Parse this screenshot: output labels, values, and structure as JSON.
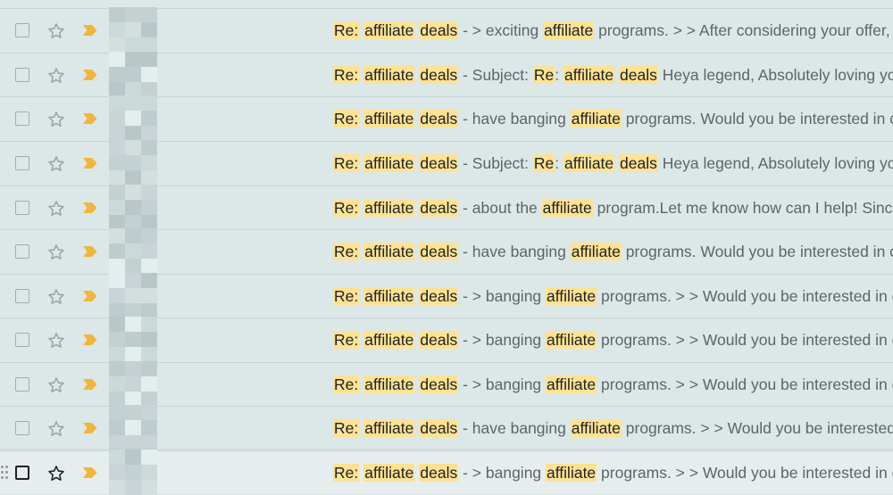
{
  "emails": [
    {
      "prefix": "Re:",
      "w1": "affiliate",
      "w2": "deals",
      "sep": "-",
      "body": [
        {
          "t": "> exciting "
        },
        {
          "t": "affiliate",
          "h": true
        },
        {
          "t": " programs. > > After considering your offer,"
        }
      ]
    },
    {
      "prefix": "Re:",
      "w1": "affiliate",
      "w2": "deals",
      "sep": "-",
      "body": [
        {
          "t": "Subject: "
        },
        {
          "t": "Re",
          "h": true
        },
        {
          "t": ": "
        },
        {
          "t": "affiliate",
          "h": true
        },
        {
          "t": " "
        },
        {
          "t": "deals",
          "h": true
        },
        {
          "t": " Heya legend, Absolutely loving you"
        }
      ]
    },
    {
      "prefix": "Re:",
      "w1": "affiliate",
      "w2": "deals",
      "sep": "-",
      "body": [
        {
          "t": "have banging "
        },
        {
          "t": "affiliate",
          "h": true
        },
        {
          "t": " programs. Would you be interested in c"
        }
      ]
    },
    {
      "prefix": "Re:",
      "w1": "affiliate",
      "w2": "deals",
      "sep": "-",
      "body": [
        {
          "t": "Subject: "
        },
        {
          "t": "Re",
          "h": true
        },
        {
          "t": ": "
        },
        {
          "t": "affiliate",
          "h": true
        },
        {
          "t": " "
        },
        {
          "t": "deals",
          "h": true
        },
        {
          "t": " Heya legend, Absolutely loving you"
        }
      ]
    },
    {
      "prefix": "Re:",
      "w1": "affiliate",
      "w2": "deals",
      "sep": "-",
      "body": [
        {
          "t": "about the "
        },
        {
          "t": "affiliate",
          "h": true
        },
        {
          "t": " program.Let me know how can I help! Sinc"
        }
      ]
    },
    {
      "prefix": "Re:",
      "w1": "affiliate",
      "w2": "deals",
      "sep": "-",
      "body": [
        {
          "t": "have banging "
        },
        {
          "t": "affiliate",
          "h": true
        },
        {
          "t": " programs. Would you be interested in c"
        }
      ]
    },
    {
      "prefix": "Re:",
      "w1": "affiliate",
      "w2": "deals",
      "sep": "-",
      "body": [
        {
          "t": "> banging "
        },
        {
          "t": "affiliate",
          "h": true
        },
        {
          "t": " programs. > > Would you be interested in c"
        }
      ]
    },
    {
      "prefix": "Re:",
      "w1": "affiliate",
      "w2": "deals",
      "sep": "-",
      "body": [
        {
          "t": "> banging "
        },
        {
          "t": "affiliate",
          "h": true
        },
        {
          "t": " programs. > > Would you be interested in c"
        }
      ]
    },
    {
      "prefix": "Re:",
      "w1": "affiliate",
      "w2": "deals",
      "sep": "-",
      "body": [
        {
          "t": "> banging "
        },
        {
          "t": "affiliate",
          "h": true
        },
        {
          "t": " programs. > > Would you be interested in c"
        }
      ]
    },
    {
      "prefix": "Re:",
      "w1": "affiliate",
      "w2": "deals",
      "sep": "-",
      "body": [
        {
          "t": "have banging "
        },
        {
          "t": "affiliate",
          "h": true
        },
        {
          "t": " programs. > > Would you be interested "
        }
      ]
    },
    {
      "prefix": "Re:",
      "w1": "affiliate",
      "w2": "deals",
      "sep": "-",
      "body": [
        {
          "t": "> banging "
        },
        {
          "t": "affiliate",
          "h": true
        },
        {
          "t": " programs. > > Would you be interested in c"
        }
      ]
    }
  ],
  "icons": {
    "checkbox": "checkbox-icon",
    "star": "star-icon",
    "important": "important-marker-icon",
    "drag": "drag-handle-icon",
    "sender": "pixelated-sender-avatar"
  },
  "colors": {
    "background": "#dce8e7",
    "highlight": "#fde293",
    "important": "#f2b53b",
    "text_muted": "#5f6368",
    "text_dark": "#202124"
  }
}
